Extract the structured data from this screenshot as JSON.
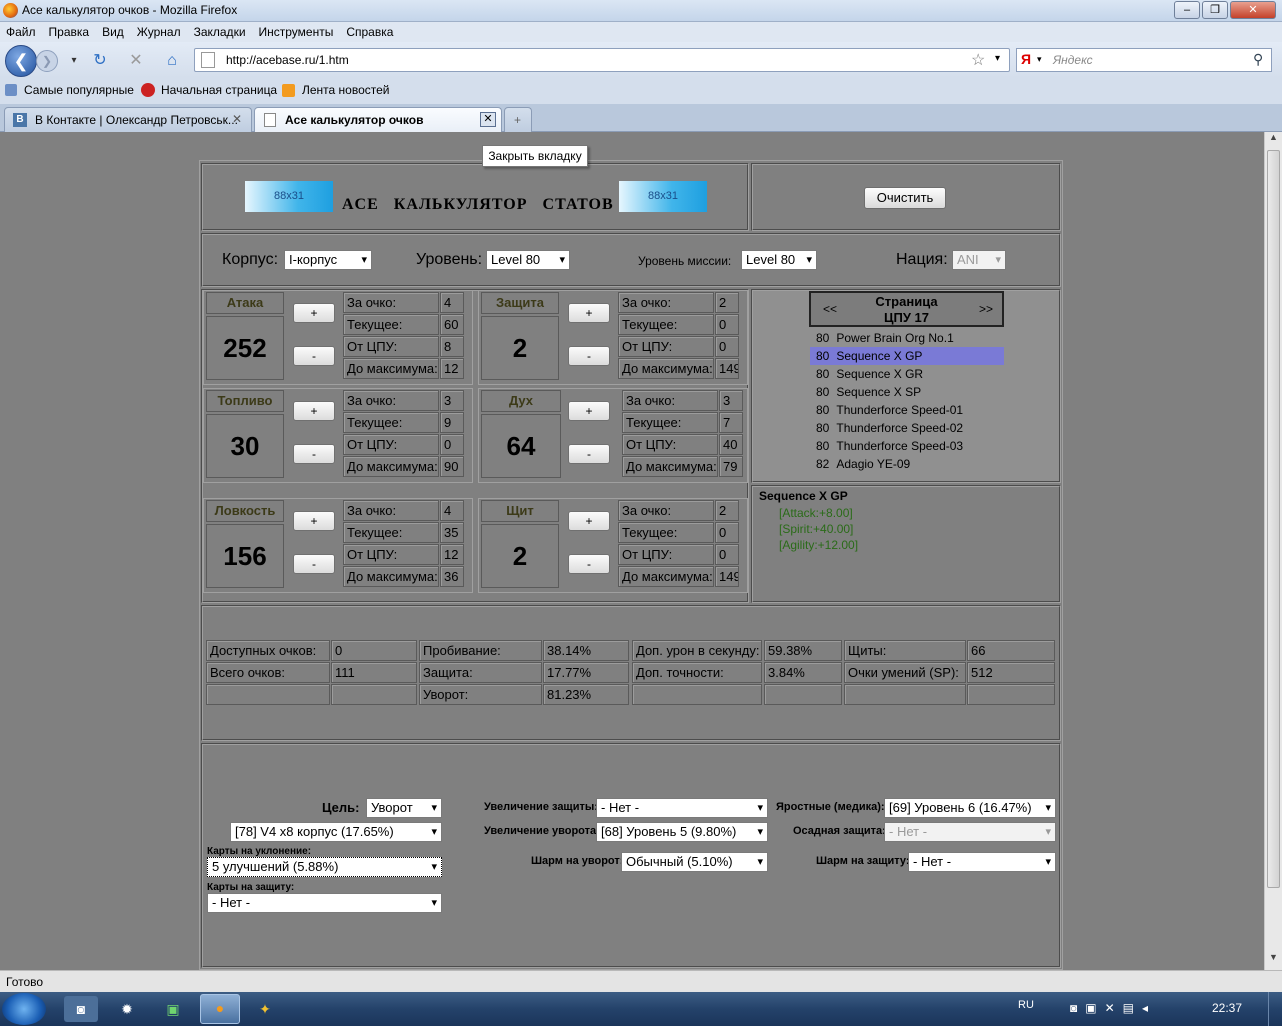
{
  "window": {
    "title": "Ace калькулятор очков - Mozilla Firefox",
    "min": "–",
    "max": "❐",
    "close": "✕"
  },
  "menu": [
    "Файл",
    "Правка",
    "Вид",
    "Журнал",
    "Закладки",
    "Инструменты",
    "Справка"
  ],
  "nav": {
    "url": "http://acebase.ru/1.htm",
    "search_placeholder": "Яндекс"
  },
  "bookmarks": [
    "Самые популярные",
    "Начальная страница",
    "Лента новостей"
  ],
  "tabs": [
    {
      "label": "В Контакте | Олександр Петровськ..."
    },
    {
      "label": "Ace калькулятор очков"
    }
  ],
  "tooltip": "Закрыть вкладку",
  "banner": {
    "badge": "88x31",
    "title": "ACE   КАЛЬКУЛЯТОР   СТАТОВ",
    "clear_button": "Очистить"
  },
  "filters": {
    "hull_label": "Корпус:",
    "hull": "I-корпус",
    "level_label": "Уровень:",
    "level": "Level 80",
    "mission_label": "Уровень миссии:",
    "mission": "Level 80",
    "nation_label": "Нация:",
    "nation": "ANI"
  },
  "stats": [
    {
      "name": "Атака",
      "value": "252",
      "per_point": "4",
      "current": "60",
      "cpu": "8",
      "to_max": "12"
    },
    {
      "name": "Защита",
      "value": "2",
      "per_point": "2",
      "current": "0",
      "cpu": "0",
      "to_max": "149"
    },
    {
      "name": "Топливо",
      "value": "30",
      "per_point": "3",
      "current": "9",
      "cpu": "0",
      "to_max": "90"
    },
    {
      "name": "Дух",
      "value": "64",
      "per_point": "3",
      "current": "7",
      "cpu": "40",
      "to_max": "79"
    },
    {
      "name": "Ловкость",
      "value": "156",
      "per_point": "4",
      "current": "35",
      "cpu": "12",
      "to_max": "36"
    },
    {
      "name": "Щит",
      "value": "2",
      "per_point": "2",
      "current": "0",
      "cpu": "0",
      "to_max": "149"
    }
  ],
  "stat_labels": {
    "per_point": "За очко:",
    "current": "Текущее:",
    "cpu": "От ЦПУ:",
    "to_max": "До максимума:",
    "plus": "+",
    "minus": "-"
  },
  "cpu": {
    "prev": "<<",
    "next": ">>",
    "page_label": "Страница",
    "page": "ЦПУ 17",
    "items": [
      {
        "lvl": "80",
        "name": "Power Brain Org No.1"
      },
      {
        "lvl": "80",
        "name": "Sequence X GP"
      },
      {
        "lvl": "80",
        "name": "Sequence X GR"
      },
      {
        "lvl": "80",
        "name": "Sequence X SP"
      },
      {
        "lvl": "80",
        "name": "Thunderforce Speed-01"
      },
      {
        "lvl": "80",
        "name": "Thunderforce Speed-02"
      },
      {
        "lvl": "80",
        "name": "Thunderforce Speed-03"
      },
      {
        "lvl": "82",
        "name": "Adagio YE-09"
      }
    ],
    "selected_index": 1,
    "detail_title": "Sequence X GP",
    "bonuses": [
      "[Attack:+8.00]",
      "[Spirit:+40.00]",
      "[Agility:+12.00]"
    ]
  },
  "summary": {
    "row1": [
      "Доступных очков:",
      "0",
      "Пробивание:",
      "38.14%",
      "Доп. урон в секунду:",
      "59.38%",
      "Щиты:",
      "66"
    ],
    "row2": [
      "Всего очков:",
      "111",
      "Защита:",
      "17.77%",
      "Доп. точности:",
      "3.84%",
      "Очки умений (SP):",
      "512"
    ],
    "row3": [
      "",
      "",
      "Уворот:",
      "81.23%",
      "",
      "",
      "",
      ""
    ]
  },
  "bottom": {
    "goal_label": "Цель:",
    "goal": "Уворот",
    "hull_item": "[78] V4 x8 корпус (17.65%)",
    "evade_cards_label": "Карты на уклонение:",
    "evade_cards": "5 улучшений (5.88%)",
    "def_cards_label": "Карты на защиту:",
    "def_cards": "- Нет -",
    "def_up_label": "Увеличение защиты:",
    "def_up": "- Нет -",
    "evade_up_label": "Увеличение уворота:",
    "evade_up": "[68] Уровень 5 (9.80%)",
    "charm_evade_label": "Шарм на уворот:",
    "charm_evade": "Обычный (5.10%)",
    "fury_label": "Яростные (медика):",
    "fury": "[69] Уровень 6 (16.47%)",
    "siege_label": "Осадная защита:",
    "siege": "- Нет -",
    "charm_def_label": "Шарм на защиту:",
    "charm_def": "- Нет -"
  },
  "status": "Готово",
  "tray": {
    "lang": "RU",
    "time": "22:37"
  }
}
